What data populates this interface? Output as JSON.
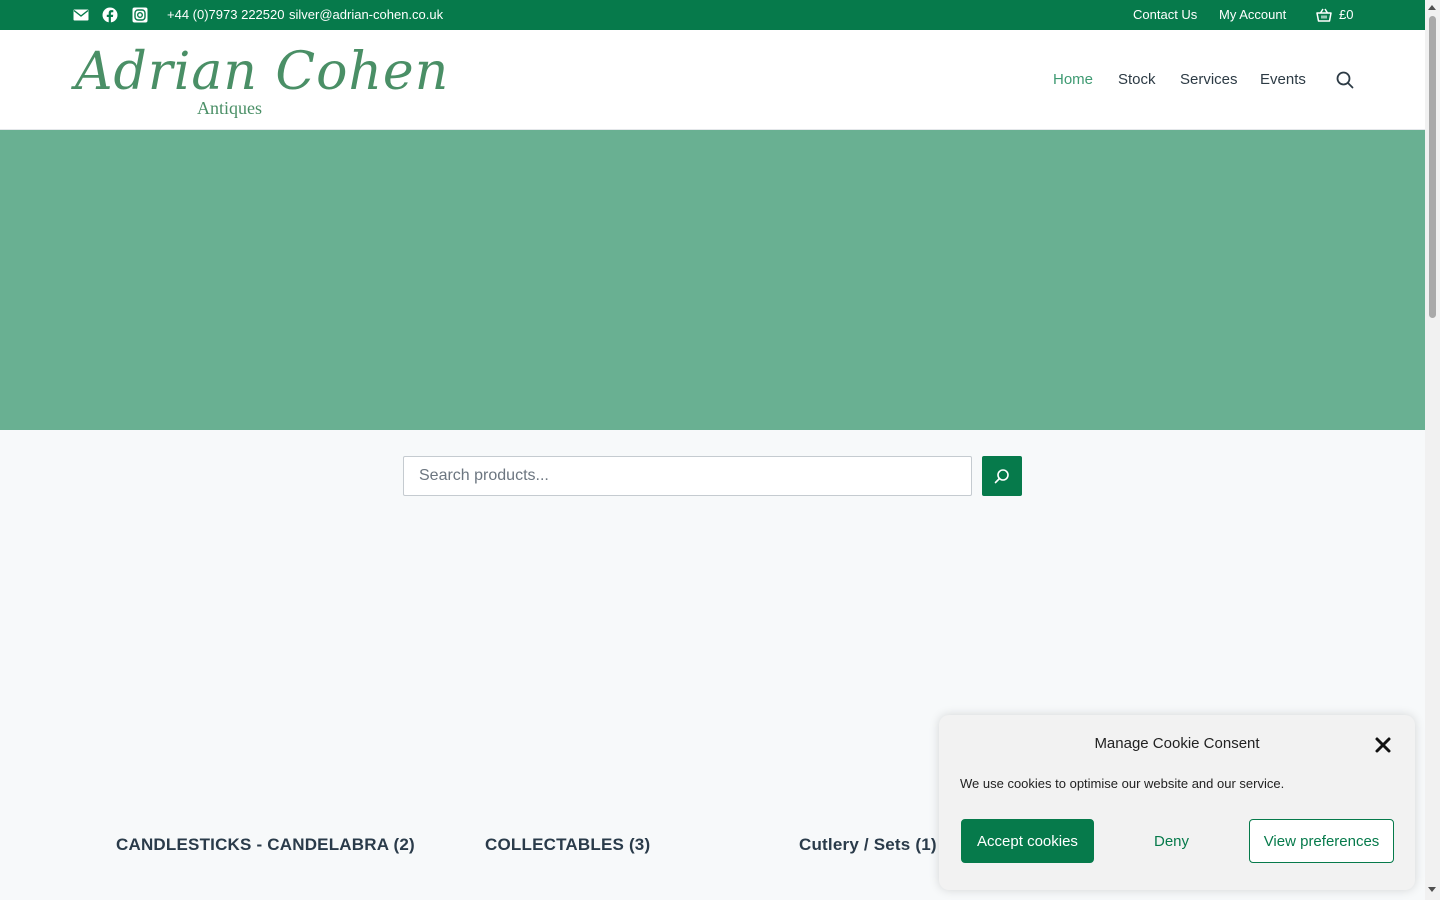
{
  "topbar": {
    "phone": "+44 (0)7973 222520",
    "email": "silver@adrian-cohen.co.uk",
    "contact_us": "Contact Us",
    "my_account": "My Account",
    "cart_total": "£0",
    "icons": [
      "mail-icon",
      "facebook-icon",
      "instagram-icon",
      "basket-icon"
    ]
  },
  "logo": {
    "script": "Adrian Cohen",
    "subtitle": "Antiques"
  },
  "nav": {
    "items": [
      {
        "label": "Home",
        "active": true
      },
      {
        "label": "Stock"
      },
      {
        "label": "Services"
      },
      {
        "label": "Events"
      }
    ]
  },
  "search": {
    "placeholder": "Search products..."
  },
  "categories": [
    {
      "label": "CANDLESTICKS - CANDELABRA (2)"
    },
    {
      "label": "COLLECTABLES (3)"
    },
    {
      "label": "Cutlery / Sets (1)"
    }
  ],
  "cookie": {
    "title": "Manage Cookie Consent",
    "text": "We use cookies to optimise our website and our service.",
    "accept": "Accept cookies",
    "deny": "Deny",
    "preferences": "View preferences"
  },
  "colors": {
    "brand_green": "#067a4b",
    "hero_green": "#69b092",
    "logo_green": "#4a8f66",
    "nav_active": "#3e9a72"
  }
}
